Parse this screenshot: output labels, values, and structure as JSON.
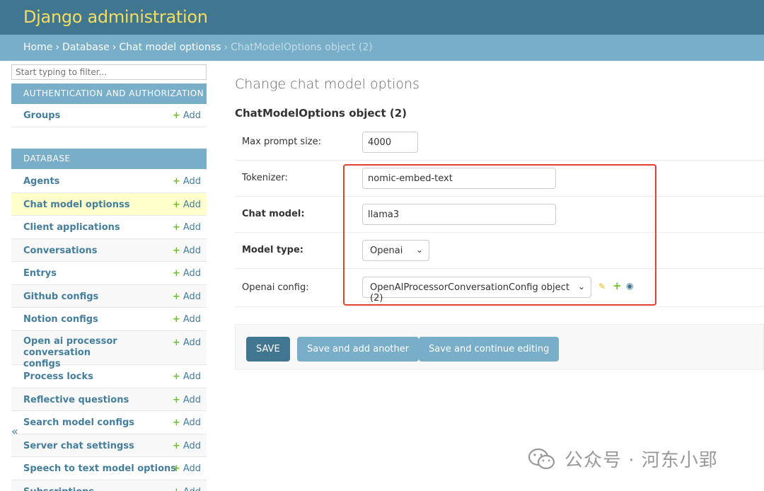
{
  "header": {
    "site_title": "Django administration"
  },
  "breadcrumbs": {
    "home": "Home",
    "app": "Database",
    "model": "Chat model optionss",
    "current": "ChatModelOptions object (2)",
    "separator": "›"
  },
  "sidebar": {
    "filter_placeholder": "Start typing to filter...",
    "add_label": "Add",
    "add_plus": "+",
    "collapse_glyph": "«",
    "sections": [
      {
        "caption": "AUTHENTICATION AND AUTHORIZATION",
        "items": [
          {
            "label": "Groups"
          }
        ]
      },
      {
        "caption": "DATABASE",
        "items": [
          {
            "label": "Agents"
          },
          {
            "label": "Chat model optionss",
            "current": true
          },
          {
            "label": "Client applications"
          },
          {
            "label": "Conversations"
          },
          {
            "label": "Entrys"
          },
          {
            "label": "Github configs"
          },
          {
            "label": "Notion configs"
          },
          {
            "label": "Open ai processor conversation configs"
          },
          {
            "label": "Process locks"
          },
          {
            "label": "Reflective questions"
          },
          {
            "label": "Search model configs"
          },
          {
            "label": "Server chat settingss"
          },
          {
            "label": "Speech to text model options"
          },
          {
            "label": "Subscriptions"
          }
        ]
      }
    ]
  },
  "main": {
    "page_title": "Change chat model options",
    "object_title": "ChatModelOptions object (2)",
    "fields": [
      {
        "label": "Max prompt size:",
        "value": "4000",
        "bold": false,
        "kind": "input"
      },
      {
        "label": "Tokenizer:",
        "value": "nomic-embed-text",
        "bold": false,
        "kind": "input"
      },
      {
        "label": "Chat model:",
        "value": "llama3",
        "bold": true,
        "kind": "input"
      },
      {
        "label": "Model type:",
        "value": "Openai",
        "bold": true,
        "kind": "select"
      },
      {
        "label": "Openai config:",
        "value": "OpenAIProcessorConversationConfig object (2)",
        "bold": false,
        "kind": "select"
      }
    ],
    "related_icons": [
      "pencil-icon",
      "plus-icon",
      "eye-icon"
    ],
    "buttons": {
      "save": "SAVE",
      "save_add": "Save and add another",
      "save_continue": "Save and continue editing"
    }
  },
  "watermark": {
    "text": "公众号 · 河东小郢"
  },
  "colors": {
    "header": "#417690",
    "breadcrumbs": "#79aec8",
    "branding": "#f5dd5d",
    "link": "#447e9b",
    "add_green": "#70bf2b",
    "highlight": "#e0432d",
    "save_button": "#417690",
    "secondary_button": "#79aec8"
  }
}
